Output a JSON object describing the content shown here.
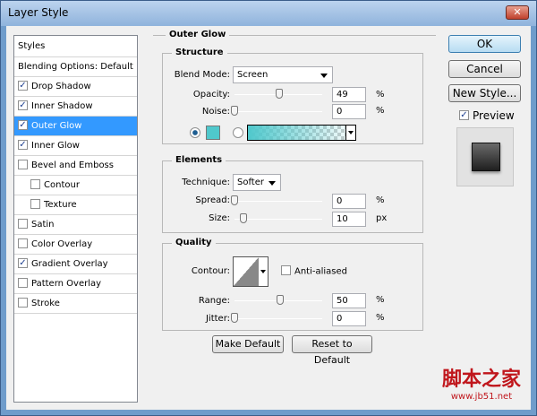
{
  "window": {
    "title": "Layer Style",
    "close": "✕"
  },
  "styles_list": {
    "header": "Styles",
    "blending": "Blending Options: Default",
    "items": [
      {
        "label": "Drop Shadow",
        "checked": true,
        "indent": false
      },
      {
        "label": "Inner Shadow",
        "checked": true,
        "indent": false
      },
      {
        "label": "Outer Glow",
        "checked": true,
        "indent": false,
        "selected": true
      },
      {
        "label": "Inner Glow",
        "checked": true,
        "indent": false
      },
      {
        "label": "Bevel and Emboss",
        "checked": false,
        "indent": false
      },
      {
        "label": "Contour",
        "checked": false,
        "indent": true
      },
      {
        "label": "Texture",
        "checked": false,
        "indent": true
      },
      {
        "label": "Satin",
        "checked": false,
        "indent": false
      },
      {
        "label": "Color Overlay",
        "checked": false,
        "indent": false
      },
      {
        "label": "Gradient Overlay",
        "checked": true,
        "indent": false
      },
      {
        "label": "Pattern Overlay",
        "checked": false,
        "indent": false
      },
      {
        "label": "Stroke",
        "checked": false,
        "indent": false
      }
    ]
  },
  "outer_glow": {
    "title": "Outer Glow",
    "structure": {
      "title": "Structure",
      "blend_mode_label": "Blend Mode:",
      "blend_mode": "Screen",
      "opacity_label": "Opacity:",
      "opacity": "49",
      "noise_label": "Noise:",
      "noise": "0",
      "pct": "%",
      "glow_color": "#4fc8cc"
    },
    "elements": {
      "title": "Elements",
      "technique_label": "Technique:",
      "technique": "Softer",
      "spread_label": "Spread:",
      "spread": "0",
      "size_label": "Size:",
      "size": "10",
      "pct": "%",
      "px": "px"
    },
    "quality": {
      "title": "Quality",
      "contour_label": "Contour:",
      "anti_aliased": "Anti-aliased",
      "range_label": "Range:",
      "range": "50",
      "jitter_label": "Jitter:",
      "jitter": "0",
      "pct": "%"
    },
    "make_default": "Make Default",
    "reset_default": "Reset to Default"
  },
  "actions": {
    "ok": "OK",
    "cancel": "Cancel",
    "new_style": "New Style...",
    "preview": "Preview",
    "check": "✓"
  },
  "watermark": {
    "cn": "脚本之家",
    "url": "www.jb51.net"
  }
}
